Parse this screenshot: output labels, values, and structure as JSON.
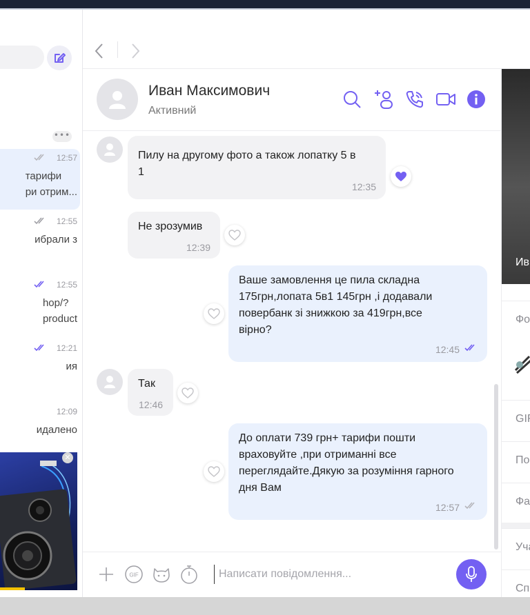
{
  "chat_list": {
    "items": [
      {
        "time": "12:57",
        "tick": "grey",
        "lines": [
          "тарифи",
          "ри отрим..."
        ]
      },
      {
        "time": "12:55",
        "tick": "grey",
        "lines": [
          "ибрали з"
        ]
      },
      {
        "time": "12:55",
        "tick": "purple",
        "lines": [
          "hop/?",
          "product"
        ]
      },
      {
        "time": "12:21",
        "tick": "purple",
        "lines": [
          "ия"
        ]
      },
      {
        "time": "12:09",
        "tick": "none",
        "lines": [
          "идалено"
        ]
      }
    ],
    "more_label": "•••"
  },
  "header": {
    "contact_name": "Иван Максимович",
    "contact_status": "Активний"
  },
  "messages": [
    {
      "dir": "in",
      "lines": [
        "Пилу на другому фото а також лопатку 5 в",
        "1"
      ],
      "time": "12:35",
      "reaction": "heart-filled"
    },
    {
      "dir": "in",
      "lines": [
        "Не зрозумив"
      ],
      "time": "12:39",
      "reaction": "heart-empty"
    },
    {
      "dir": "out",
      "lines": [
        "Ваше замовлення це пила складна",
        "175грн,лопата 5в1 145грн ,і додавали",
        "повербанк зі знижкою за 419грн,все",
        "вірно?"
      ],
      "time": "12:45",
      "status": "read",
      "reaction": "heart-empty"
    },
    {
      "dir": "in",
      "lines": [
        "Так"
      ],
      "time": "12:46",
      "reaction": "heart-empty"
    },
    {
      "dir": "out",
      "lines": [
        "До оплати 739 грн+ тарифи пошти",
        "враховуйте ,при отриманні все",
        "переглядайте.Дякую за розуміння гарного",
        "дня Вам"
      ],
      "time": "12:57",
      "status": "delivered",
      "reaction": "heart-empty"
    }
  ],
  "composer": {
    "placeholder": "Написати повідомлення..."
  },
  "right_panel": {
    "photo_name": "Ив",
    "rows": [
      "Фо",
      "GIF",
      "По",
      "Фа",
      "Уча",
      "Спі"
    ]
  },
  "colors": {
    "accent": "#7360f2",
    "incoming_bubble": "#f2f2f4",
    "outgoing_bubble": "#eaf1fd"
  }
}
